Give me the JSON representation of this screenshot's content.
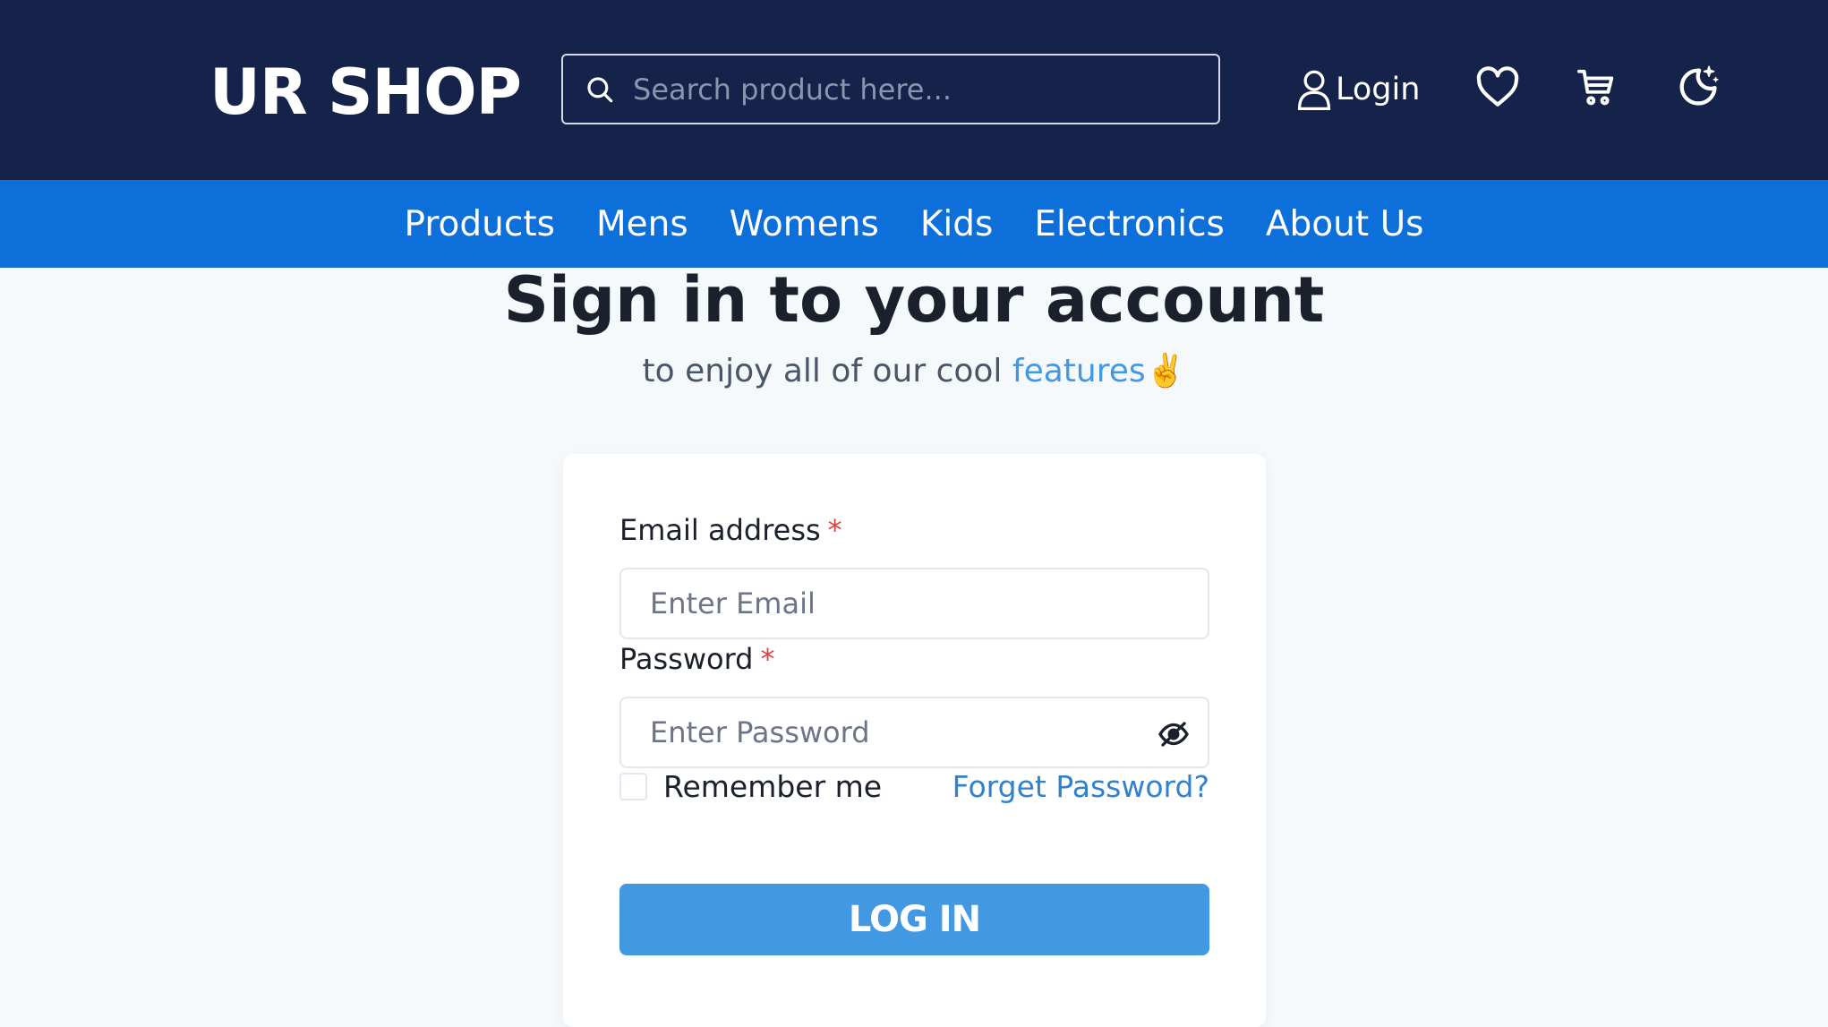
{
  "header": {
    "logo": "UR SHOP",
    "search_placeholder": "Search product here...",
    "login_label": "Login",
    "icons": [
      "search-icon",
      "user-icon",
      "heart-icon",
      "cart-icon",
      "moon-icon"
    ]
  },
  "nav": {
    "items": [
      "Products",
      "Mens",
      "Womens",
      "Kids",
      "Electronics",
      "About Us"
    ]
  },
  "page": {
    "title": "Sign in to your account",
    "subtitle_prefix": "to enjoy all of our cool ",
    "subtitle_link": "features",
    "subtitle_emoji": "✌️"
  },
  "form": {
    "email_label": "Email address",
    "email_placeholder": "Enter Email",
    "password_label": "Password",
    "password_placeholder": "Enter Password",
    "required_mark": "*",
    "remember_label": "Remember me",
    "forgot_label": "Forget Password?",
    "submit_label": "LOG IN"
  },
  "colors": {
    "header_bg": "#15224a",
    "nav_bg": "#0d6fda",
    "page_bg": "#f6f9fc",
    "accent": "#4299e1",
    "required": "#e53e3e"
  }
}
